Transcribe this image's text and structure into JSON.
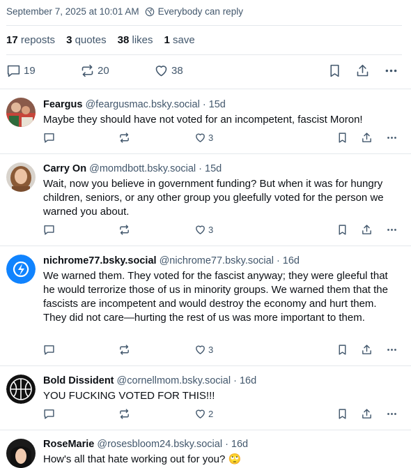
{
  "meta": {
    "timestamp": "September 7, 2025 at 10:01 AM",
    "reply_setting": "Everybody can reply"
  },
  "stats": {
    "reposts_count": "17",
    "reposts_label": "reposts",
    "quotes_count": "3",
    "quotes_label": "quotes",
    "likes_count": "38",
    "likes_label": "likes",
    "saves_count": "1",
    "saves_label": "save"
  },
  "actions": {
    "reply_count": "19",
    "repost_count": "20",
    "like_count": "38"
  },
  "replies": [
    {
      "name": "Feargus",
      "handle": "@feargusmac.bsky.social · 15d",
      "text": "Maybe they should have not voted for an incompetent, fascist Moron!",
      "likes": "3"
    },
    {
      "name": "Carry On",
      "handle": "@momdbott.bsky.social · 15d",
      "text": "Wait, now you believe in government funding? But when it was for hungry children, seniors, or any other group you gleefully voted for the person we warned you about.",
      "likes": "3"
    },
    {
      "name": "nichrome77.bsky.social",
      "handle": "@nichrome77.bsky.social · 16d",
      "text": "We warned them. They voted for the fascist anyway; they were gleeful that he would terrorize those of us in minority groups. We warned them that the fascists are incompetent and would destroy the economy and hurt them. They did not care—hurting the rest of us was more important to them.",
      "likes": "3"
    },
    {
      "name": "Bold Dissident",
      "handle": "@cornellmom.bsky.social · 16d",
      "text": "YOU FUCKING VOTED FOR THIS!!!",
      "likes": "2"
    },
    {
      "name": "RoseMarie",
      "handle": "@rosesbloom24.bsky.social · 16d",
      "text": "How's all that hate working out for you? 🙄",
      "likes": ""
    }
  ],
  "colors": {
    "text": "#0b0f14",
    "muted": "#42576c",
    "divider": "#e4e8ec",
    "accent": "#1083fe"
  }
}
